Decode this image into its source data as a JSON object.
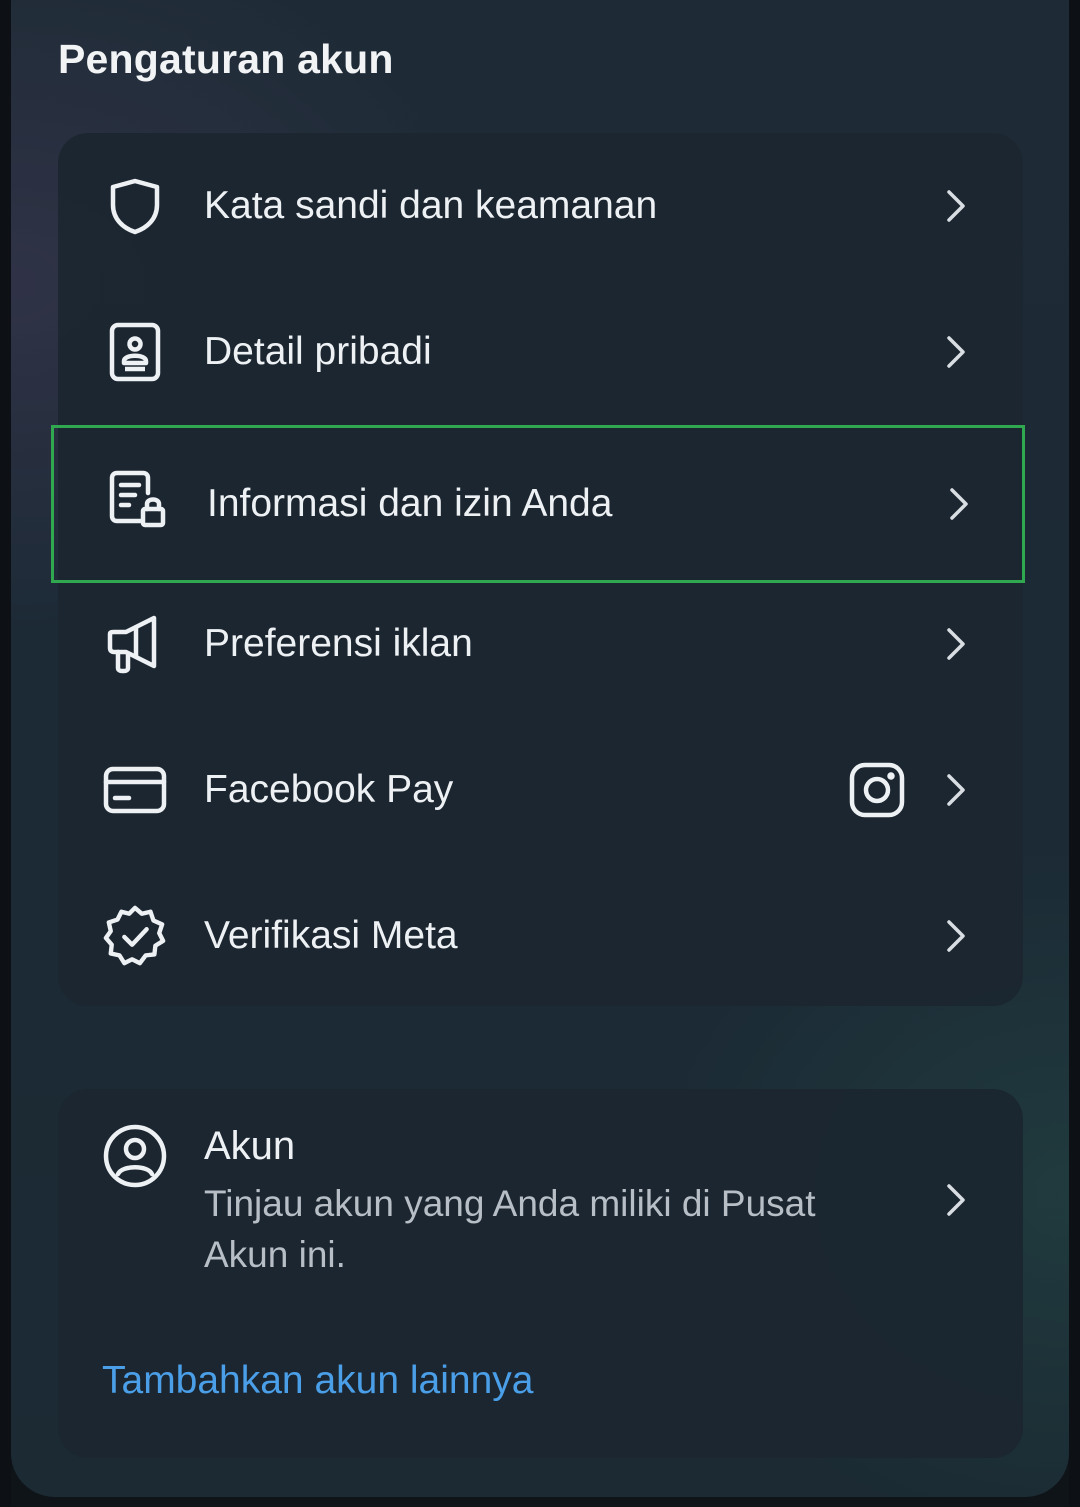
{
  "page": {
    "title": "Pengaturan akun"
  },
  "settings": {
    "items": [
      {
        "label": "Kata sandi dan keamanan",
        "icon": "shield-icon"
      },
      {
        "label": "Detail pribadi",
        "icon": "id-card-icon"
      },
      {
        "label": "Informasi dan izin Anda",
        "icon": "document-lock-icon",
        "highlighted": true
      },
      {
        "label": "Preferensi iklan",
        "icon": "megaphone-icon"
      },
      {
        "label": "Facebook Pay",
        "icon": "credit-card-icon",
        "badge_icon": "instagram-icon"
      },
      {
        "label": "Verifikasi Meta",
        "icon": "verified-badge-icon"
      }
    ]
  },
  "account": {
    "title": "Akun",
    "description": "Tinjau akun yang Anda miliki di Pusat Akun ini.",
    "add_link": "Tambahkan akun lainnya",
    "icon": "user-circle-icon"
  },
  "colors": {
    "highlight_border": "#2fa84f",
    "link": "#4a9fe8",
    "text_primary": "#eef1f4",
    "text_secondary": "#b7bec6"
  }
}
